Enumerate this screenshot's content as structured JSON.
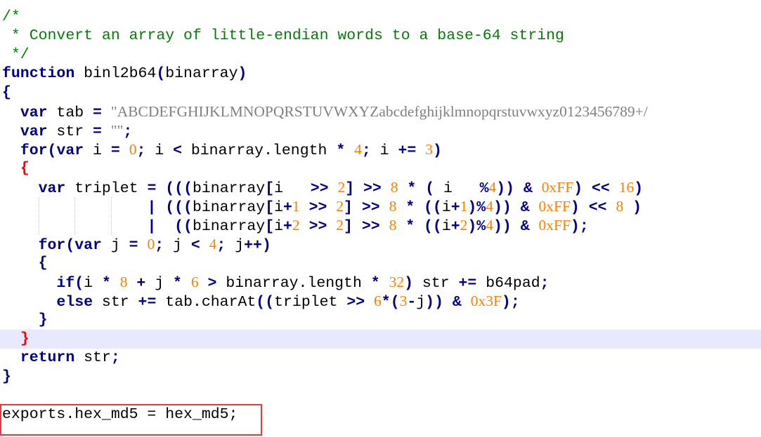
{
  "editor": {
    "lines": [
      {
        "tokens": [
          {
            "t": "c",
            "v": "/*"
          }
        ]
      },
      {
        "tokens": [
          {
            "t": "c",
            "v": " * Convert an array of little-endian words to a base-64 string"
          }
        ]
      },
      {
        "tokens": [
          {
            "t": "c",
            "v": " */"
          }
        ]
      },
      {
        "tokens": [
          {
            "t": "k",
            "v": "function"
          },
          {
            "t": "id",
            "v": " binl2b64"
          },
          {
            "t": "o",
            "v": "("
          },
          {
            "t": "id",
            "v": "binarray"
          },
          {
            "t": "o",
            "v": ")"
          }
        ]
      },
      {
        "tokens": [
          {
            "t": "o",
            "v": "{"
          }
        ]
      },
      {
        "tokens": [
          {
            "t": "id",
            "v": "  "
          },
          {
            "t": "k",
            "v": "var"
          },
          {
            "t": "id",
            "v": " tab "
          },
          {
            "t": "o",
            "v": "="
          },
          {
            "t": "id",
            "v": " "
          },
          {
            "t": "s",
            "v": "\"ABCDEFGHIJKLMNOPQRSTUVWXYZabcdefghijklmnopqrstuvwxyz0123456789+/"
          }
        ]
      },
      {
        "tokens": [
          {
            "t": "id",
            "v": "  "
          },
          {
            "t": "k",
            "v": "var"
          },
          {
            "t": "id",
            "v": " str "
          },
          {
            "t": "o",
            "v": "="
          },
          {
            "t": "id",
            "v": " "
          },
          {
            "t": "s",
            "v": "\"\""
          },
          {
            "t": "o",
            "v": ";"
          }
        ]
      },
      {
        "tokens": [
          {
            "t": "id",
            "v": "  "
          },
          {
            "t": "k",
            "v": "for"
          },
          {
            "t": "o",
            "v": "("
          },
          {
            "t": "k",
            "v": "var"
          },
          {
            "t": "id",
            "v": " i "
          },
          {
            "t": "o",
            "v": "="
          },
          {
            "t": "id",
            "v": " "
          },
          {
            "t": "n",
            "v": "0"
          },
          {
            "t": "o",
            "v": ";"
          },
          {
            "t": "id",
            "v": " i "
          },
          {
            "t": "o",
            "v": "<"
          },
          {
            "t": "id",
            "v": " binarray.length "
          },
          {
            "t": "o",
            "v": "*"
          },
          {
            "t": "id",
            "v": " "
          },
          {
            "t": "n",
            "v": "4"
          },
          {
            "t": "o",
            "v": ";"
          },
          {
            "t": "id",
            "v": " i "
          },
          {
            "t": "o",
            "v": "+="
          },
          {
            "t": "id",
            "v": " "
          },
          {
            "t": "n",
            "v": "3"
          },
          {
            "t": "o",
            "v": ")"
          }
        ]
      },
      {
        "tokens": [
          {
            "t": "id",
            "v": "  "
          },
          {
            "t": "br",
            "v": "{"
          }
        ]
      },
      {
        "tokens": [
          {
            "t": "id",
            "v": "    "
          },
          {
            "t": "k",
            "v": "var"
          },
          {
            "t": "id",
            "v": " triplet "
          },
          {
            "t": "o",
            "v": "="
          },
          {
            "t": "id",
            "v": " "
          },
          {
            "t": "o",
            "v": "((("
          },
          {
            "t": "id",
            "v": "binarray"
          },
          {
            "t": "o",
            "v": "["
          },
          {
            "t": "id",
            "v": "i   "
          },
          {
            "t": "o",
            "v": ">>"
          },
          {
            "t": "id",
            "v": " "
          },
          {
            "t": "n",
            "v": "2"
          },
          {
            "t": "o",
            "v": "]"
          },
          {
            "t": "id",
            "v": " "
          },
          {
            "t": "o",
            "v": ">>"
          },
          {
            "t": "id",
            "v": " "
          },
          {
            "t": "n",
            "v": "8"
          },
          {
            "t": "id",
            "v": " "
          },
          {
            "t": "o",
            "v": "*"
          },
          {
            "t": "id",
            "v": " "
          },
          {
            "t": "o",
            "v": "("
          },
          {
            "t": "id",
            "v": " i   "
          },
          {
            "t": "o",
            "v": "%"
          },
          {
            "t": "n",
            "v": "4"
          },
          {
            "t": "o",
            "v": "))"
          },
          {
            "t": "id",
            "v": " "
          },
          {
            "t": "o",
            "v": "&"
          },
          {
            "t": "id",
            "v": " "
          },
          {
            "t": "n",
            "v": "0xFF"
          },
          {
            "t": "o",
            "v": ")"
          },
          {
            "t": "id",
            "v": " "
          },
          {
            "t": "o",
            "v": "<<"
          },
          {
            "t": "id",
            "v": " "
          },
          {
            "t": "n",
            "v": "16"
          },
          {
            "t": "o",
            "v": ")"
          }
        ]
      },
      {
        "tokens": [
          {
            "t": "id",
            "v": "                "
          },
          {
            "t": "o",
            "v": "|"
          },
          {
            "t": "id",
            "v": " "
          },
          {
            "t": "o",
            "v": "((("
          },
          {
            "t": "id",
            "v": "binarray"
          },
          {
            "t": "o",
            "v": "["
          },
          {
            "t": "id",
            "v": "i"
          },
          {
            "t": "o",
            "v": "+"
          },
          {
            "t": "n",
            "v": "1"
          },
          {
            "t": "id",
            "v": " "
          },
          {
            "t": "o",
            "v": ">>"
          },
          {
            "t": "id",
            "v": " "
          },
          {
            "t": "n",
            "v": "2"
          },
          {
            "t": "o",
            "v": "]"
          },
          {
            "t": "id",
            "v": " "
          },
          {
            "t": "o",
            "v": ">>"
          },
          {
            "t": "id",
            "v": " "
          },
          {
            "t": "n",
            "v": "8"
          },
          {
            "t": "id",
            "v": " "
          },
          {
            "t": "o",
            "v": "*"
          },
          {
            "t": "id",
            "v": " "
          },
          {
            "t": "o",
            "v": "(("
          },
          {
            "t": "id",
            "v": "i"
          },
          {
            "t": "o",
            "v": "+"
          },
          {
            "t": "n",
            "v": "1"
          },
          {
            "t": "o",
            "v": ")%"
          },
          {
            "t": "n",
            "v": "4"
          },
          {
            "t": "o",
            "v": "))"
          },
          {
            "t": "id",
            "v": " "
          },
          {
            "t": "o",
            "v": "&"
          },
          {
            "t": "id",
            "v": " "
          },
          {
            "t": "n",
            "v": "0xFF"
          },
          {
            "t": "o",
            "v": ")"
          },
          {
            "t": "id",
            "v": " "
          },
          {
            "t": "o",
            "v": "<<"
          },
          {
            "t": "id",
            "v": " "
          },
          {
            "t": "n",
            "v": "8"
          },
          {
            "t": "id",
            "v": " "
          },
          {
            "t": "o",
            "v": ")"
          }
        ]
      },
      {
        "tokens": [
          {
            "t": "id",
            "v": "                "
          },
          {
            "t": "o",
            "v": "|"
          },
          {
            "t": "id",
            "v": "  "
          },
          {
            "t": "o",
            "v": "(("
          },
          {
            "t": "id",
            "v": "binarray"
          },
          {
            "t": "o",
            "v": "["
          },
          {
            "t": "id",
            "v": "i"
          },
          {
            "t": "o",
            "v": "+"
          },
          {
            "t": "n",
            "v": "2"
          },
          {
            "t": "id",
            "v": " "
          },
          {
            "t": "o",
            "v": ">>"
          },
          {
            "t": "id",
            "v": " "
          },
          {
            "t": "n",
            "v": "2"
          },
          {
            "t": "o",
            "v": "]"
          },
          {
            "t": "id",
            "v": " "
          },
          {
            "t": "o",
            "v": ">>"
          },
          {
            "t": "id",
            "v": " "
          },
          {
            "t": "n",
            "v": "8"
          },
          {
            "t": "id",
            "v": " "
          },
          {
            "t": "o",
            "v": "*"
          },
          {
            "t": "id",
            "v": " "
          },
          {
            "t": "o",
            "v": "(("
          },
          {
            "t": "id",
            "v": "i"
          },
          {
            "t": "o",
            "v": "+"
          },
          {
            "t": "n",
            "v": "2"
          },
          {
            "t": "o",
            "v": ")%"
          },
          {
            "t": "n",
            "v": "4"
          },
          {
            "t": "o",
            "v": "))"
          },
          {
            "t": "id",
            "v": " "
          },
          {
            "t": "o",
            "v": "&"
          },
          {
            "t": "id",
            "v": " "
          },
          {
            "t": "n",
            "v": "0xFF"
          },
          {
            "t": "o",
            "v": ");"
          }
        ]
      },
      {
        "tokens": [
          {
            "t": "id",
            "v": "    "
          },
          {
            "t": "k",
            "v": "for"
          },
          {
            "t": "o",
            "v": "("
          },
          {
            "t": "k",
            "v": "var"
          },
          {
            "t": "id",
            "v": " j "
          },
          {
            "t": "o",
            "v": "="
          },
          {
            "t": "id",
            "v": " "
          },
          {
            "t": "n",
            "v": "0"
          },
          {
            "t": "o",
            "v": ";"
          },
          {
            "t": "id",
            "v": " j "
          },
          {
            "t": "o",
            "v": "<"
          },
          {
            "t": "id",
            "v": " "
          },
          {
            "t": "n",
            "v": "4"
          },
          {
            "t": "o",
            "v": ";"
          },
          {
            "t": "id",
            "v": " j"
          },
          {
            "t": "o",
            "v": "++)"
          }
        ]
      },
      {
        "tokens": [
          {
            "t": "id",
            "v": "    "
          },
          {
            "t": "o",
            "v": "{"
          }
        ]
      },
      {
        "tokens": [
          {
            "t": "id",
            "v": "      "
          },
          {
            "t": "k",
            "v": "if"
          },
          {
            "t": "o",
            "v": "("
          },
          {
            "t": "id",
            "v": "i "
          },
          {
            "t": "o",
            "v": "*"
          },
          {
            "t": "id",
            "v": " "
          },
          {
            "t": "n",
            "v": "8"
          },
          {
            "t": "id",
            "v": " "
          },
          {
            "t": "o",
            "v": "+"
          },
          {
            "t": "id",
            "v": " j "
          },
          {
            "t": "o",
            "v": "*"
          },
          {
            "t": "id",
            "v": " "
          },
          {
            "t": "n",
            "v": "6"
          },
          {
            "t": "id",
            "v": " "
          },
          {
            "t": "o",
            "v": ">"
          },
          {
            "t": "id",
            "v": " binarray.length "
          },
          {
            "t": "o",
            "v": "*"
          },
          {
            "t": "id",
            "v": " "
          },
          {
            "t": "n",
            "v": "32"
          },
          {
            "t": "o",
            "v": ")"
          },
          {
            "t": "id",
            "v": " str "
          },
          {
            "t": "o",
            "v": "+="
          },
          {
            "t": "id",
            "v": " b64pad"
          },
          {
            "t": "o",
            "v": ";"
          }
        ]
      },
      {
        "tokens": [
          {
            "t": "id",
            "v": "      "
          },
          {
            "t": "k",
            "v": "else"
          },
          {
            "t": "id",
            "v": " str "
          },
          {
            "t": "o",
            "v": "+="
          },
          {
            "t": "id",
            "v": " tab.charAt"
          },
          {
            "t": "o",
            "v": "(("
          },
          {
            "t": "id",
            "v": "triplet "
          },
          {
            "t": "o",
            "v": ">>"
          },
          {
            "t": "id",
            "v": " "
          },
          {
            "t": "n",
            "v": "6"
          },
          {
            "t": "o",
            "v": "*("
          },
          {
            "t": "n",
            "v": "3"
          },
          {
            "t": "o",
            "v": "-"
          },
          {
            "t": "id",
            "v": "j"
          },
          {
            "t": "o",
            "v": "))"
          },
          {
            "t": "id",
            "v": " "
          },
          {
            "t": "o",
            "v": "&"
          },
          {
            "t": "id",
            "v": " "
          },
          {
            "t": "n",
            "v": "0x3F"
          },
          {
            "t": "o",
            "v": ");"
          }
        ]
      },
      {
        "tokens": [
          {
            "t": "id",
            "v": "    "
          },
          {
            "t": "o",
            "v": "}"
          }
        ]
      },
      {
        "tokens": [
          {
            "t": "id",
            "v": "  "
          },
          {
            "t": "br",
            "v": "}"
          }
        ],
        "current": true
      },
      {
        "tokens": [
          {
            "t": "id",
            "v": "  "
          },
          {
            "t": "k",
            "v": "return"
          },
          {
            "t": "id",
            "v": " str"
          },
          {
            "t": "o",
            "v": ";"
          }
        ]
      },
      {
        "tokens": [
          {
            "t": "o",
            "v": "}"
          }
        ]
      },
      {
        "tokens": [
          {
            "t": "id",
            "v": ""
          }
        ]
      },
      {
        "tokens": [
          {
            "t": "id",
            "v": "exports.hex_md5 = hex_md5;"
          }
        ],
        "highlighted": true
      }
    ]
  },
  "colors": {
    "comment": "#008000",
    "keyword": "#00008b",
    "string": "#808080",
    "number": "#ff8000",
    "brace_match": "#ff0000",
    "current_line": "#e8e8ff",
    "annotation_box": "#e03c3c"
  }
}
